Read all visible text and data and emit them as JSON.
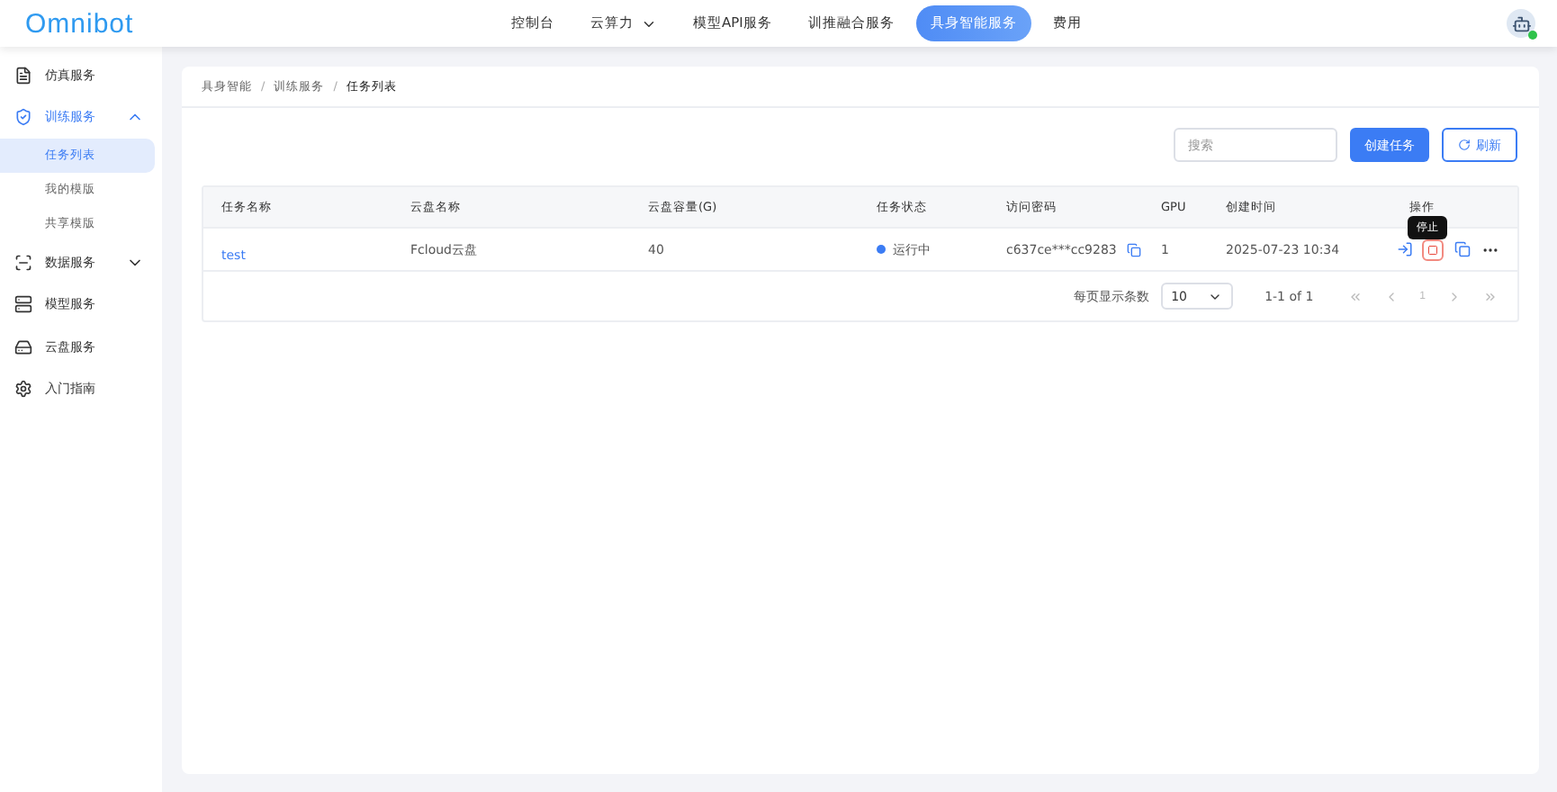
{
  "logo": "Omnibot",
  "nav": [
    {
      "label": "控制台",
      "selected": false,
      "dropdown": false
    },
    {
      "label": "云算力",
      "selected": false,
      "dropdown": true
    },
    {
      "label": "模型API服务",
      "selected": false,
      "dropdown": false
    },
    {
      "label": "训推融合服务",
      "selected": false,
      "dropdown": false
    },
    {
      "label": "具身智能服务",
      "selected": true,
      "dropdown": false
    },
    {
      "label": "费用",
      "selected": false,
      "dropdown": false
    }
  ],
  "sidebar": {
    "items": [
      {
        "label": "仿真服务",
        "selected": false
      },
      {
        "label": "训练服务",
        "selected": true,
        "expanded": true,
        "children": [
          {
            "label": "任务列表",
            "selected": true
          },
          {
            "label": "我的模版",
            "selected": false
          },
          {
            "label": "共享模版",
            "selected": false
          }
        ]
      },
      {
        "label": "数据服务",
        "selected": false,
        "expanded": false
      },
      {
        "label": "模型服务",
        "selected": false
      },
      {
        "label": "云盘服务",
        "selected": false
      },
      {
        "label": "入门指南",
        "selected": false
      }
    ]
  },
  "breadcrumb": {
    "items": [
      "具身智能",
      "训练服务",
      "任务列表"
    ],
    "separators": [
      "/",
      "/"
    ]
  },
  "search": {
    "placeholder": "搜索"
  },
  "buttons": {
    "create": "创建任务",
    "refresh": "刷新"
  },
  "table": {
    "columns": [
      "任务名称",
      "云盘名称",
      "云盘容量(G)",
      "任务状态",
      "访问密码",
      "GPU",
      "创建时间",
      "操作"
    ],
    "rows": [
      {
        "name": "test",
        "disk": "Fcloud云盘",
        "capacity": "40",
        "status": "运行中",
        "password": "c637ce***cc9283",
        "gpu": "1",
        "created": "2025-07-23 10:34"
      }
    ]
  },
  "tooltip": "停止",
  "pagination": {
    "page_size_label": "每页显示条数",
    "page_size": "10",
    "range": "1-1 of 1",
    "page": "1"
  }
}
